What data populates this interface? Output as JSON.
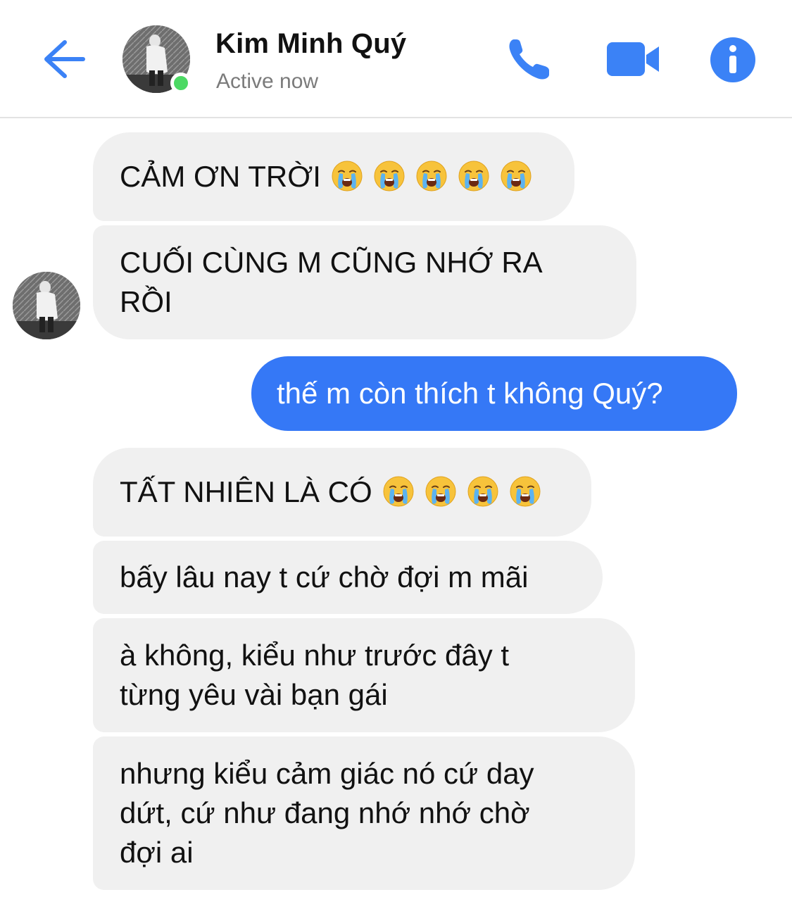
{
  "header": {
    "contact_name": "Kim Minh Quý",
    "status": "Active now",
    "back_icon": "arrow-left-icon",
    "actions": [
      {
        "icon": "phone-icon"
      },
      {
        "icon": "video-camera-icon"
      },
      {
        "icon": "info-icon"
      }
    ]
  },
  "messages": [
    {
      "from": "contact",
      "text": "CẢM ƠN TRỜI",
      "emoji": "loudly-crying-face",
      "emoji_count": 5
    },
    {
      "from": "contact",
      "text": "CUỐI CÙNG M CŨNG NHỚ RA\nRỒI"
    },
    {
      "from": "me",
      "text": "thế m còn thích t không Quý?"
    },
    {
      "from": "contact",
      "text": "TẤT NHIÊN LÀ CÓ",
      "emoji": "loudly-crying-face",
      "emoji_count": 4
    },
    {
      "from": "contact",
      "text": "bấy lâu nay t cứ chờ đợi m mãi"
    },
    {
      "from": "contact",
      "text": "à không, kiểu như trước đây t\ntừng yêu vài bạn gái"
    },
    {
      "from": "contact",
      "text": "nhưng kiểu cảm giác nó cứ day\ndứt, cứ như đang nhớ nhớ chờ\nđợi ai"
    }
  ],
  "colors": {
    "accent": "#3578f6",
    "icon_blue": "#3b82f6",
    "received_bubble": "#f0f0f0",
    "online": "#4cd964"
  }
}
